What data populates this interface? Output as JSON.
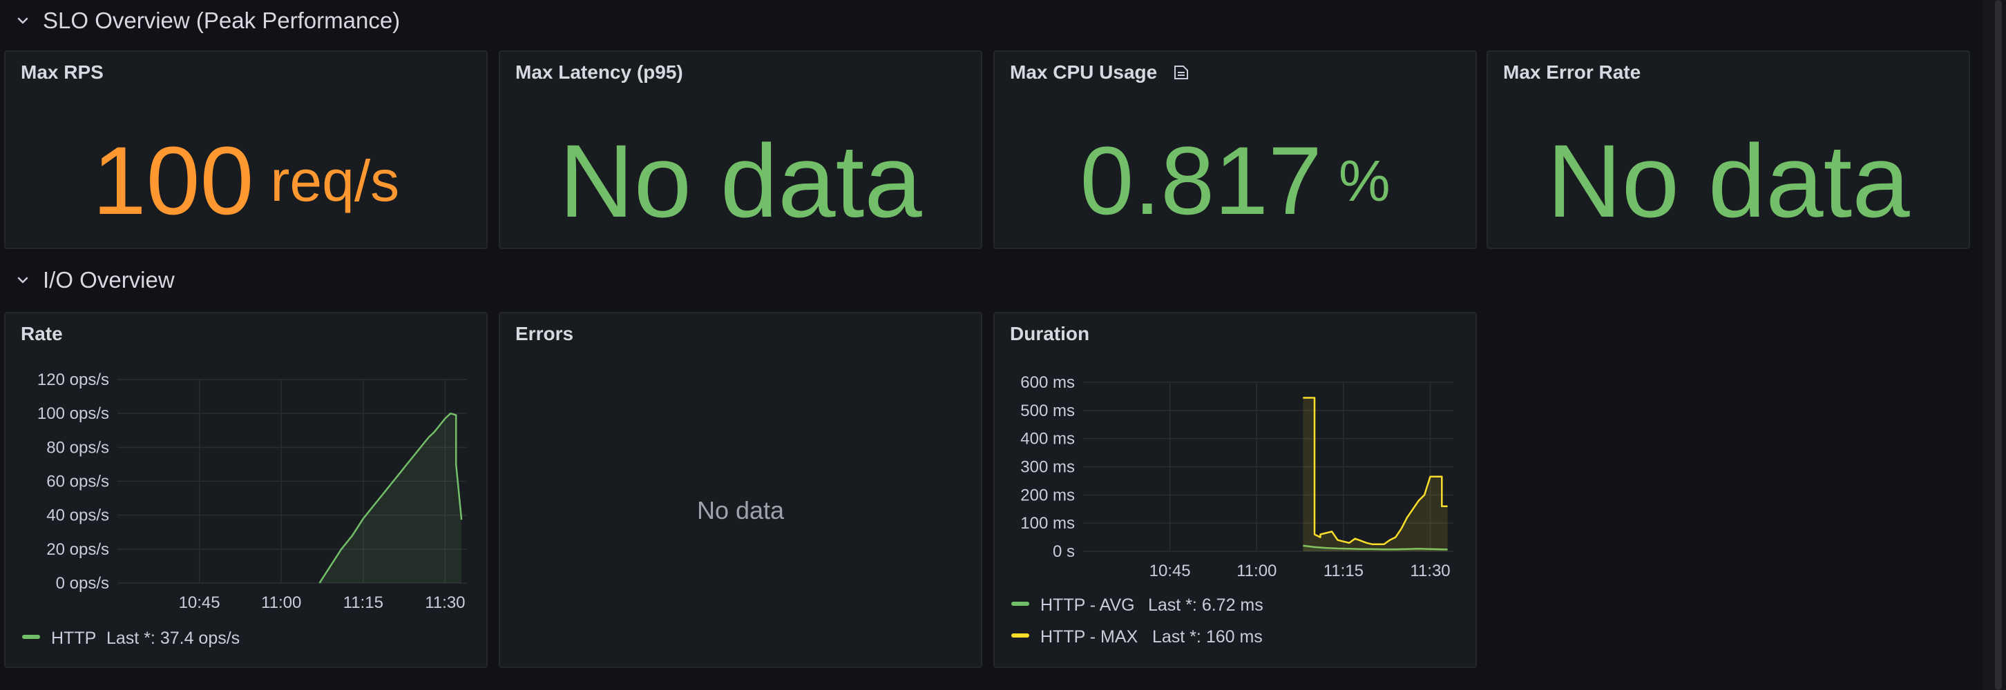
{
  "rows": [
    {
      "title": "SLO Overview (Peak Performance)"
    },
    {
      "title": "I/O Overview"
    }
  ],
  "stats": [
    {
      "title": "Max RPS",
      "value": "100",
      "unit": "req/s",
      "color": "#ff9830"
    },
    {
      "title": "Max Latency (p95)",
      "value": "No data",
      "unit": "",
      "color": "#73bf69"
    },
    {
      "title": "Max CPU Usage",
      "value": "0.817",
      "unit": "%",
      "color": "#73bf69"
    },
    {
      "title": "Max Error Rate",
      "value": "No data",
      "unit": "",
      "color": "#73bf69"
    }
  ],
  "panels": {
    "rate": {
      "title": "Rate"
    },
    "errors": {
      "title": "Errors",
      "message": "No data"
    },
    "duration": {
      "title": "Duration"
    }
  },
  "chart_data": [
    {
      "type": "area",
      "title": "Rate",
      "x_ticks": [
        "10:45",
        "11:00",
        "11:15",
        "11:30"
      ],
      "y_ticks": [
        "0 ops/s",
        "20 ops/s",
        "40 ops/s",
        "60 ops/s",
        "80 ops/s",
        "100 ops/s",
        "120 ops/s"
      ],
      "ylim": [
        0,
        120
      ],
      "grid": true,
      "legend": "bottom-left",
      "series": [
        {
          "name": "HTTP",
          "legend_text": "Last *: 37.4 ops/s",
          "color": "#73bf69",
          "x": [
            "11:07",
            "11:08",
            "11:09",
            "11:10",
            "11:11",
            "11:12",
            "11:13",
            "11:14",
            "11:15",
            "11:16",
            "11:17",
            "11:18",
            "11:19",
            "11:20",
            "11:21",
            "11:22",
            "11:23",
            "11:24",
            "11:25",
            "11:26",
            "11:27",
            "11:28",
            "11:29",
            "11:30",
            "11:31",
            "11:32",
            "11:32",
            "11:33"
          ],
          "values": [
            0,
            5,
            10,
            15,
            20,
            24,
            28,
            33,
            38,
            42,
            46,
            50,
            54,
            58,
            62,
            66,
            70,
            74,
            78,
            82,
            86,
            89,
            93,
            97,
            100,
            99,
            70,
            37.4
          ]
        }
      ]
    },
    {
      "type": "line",
      "title": "Duration",
      "x_ticks": [
        "10:45",
        "11:00",
        "11:15",
        "11:30"
      ],
      "y_ticks": [
        "0 s",
        "100 ms",
        "200 ms",
        "300 ms",
        "400 ms",
        "500 ms",
        "600 ms"
      ],
      "ylim": [
        0,
        600
      ],
      "grid": true,
      "legend": "bottom-left",
      "series": [
        {
          "name": "HTTP - AVG",
          "legend_text": "Last *: 6.72 ms",
          "color": "#73bf69",
          "x": [
            "11:08",
            "11:10",
            "11:12",
            "11:14",
            "11:16",
            "11:18",
            "11:20",
            "11:22",
            "11:24",
            "11:26",
            "11:28",
            "11:30",
            "11:32",
            "11:33"
          ],
          "values": [
            20,
            15,
            12,
            10,
            9,
            8,
            8,
            7,
            7,
            8,
            9,
            8,
            7,
            6.72
          ]
        },
        {
          "name": "HTTP - MAX",
          "legend_text": "Last *: 160 ms",
          "color": "#fade2a",
          "x": [
            "11:08",
            "11:10",
            "11:10",
            "11:11",
            "11:11",
            "11:13",
            "11:14",
            "11:16",
            "11:17",
            "11:19",
            "11:20",
            "11:22",
            "11:23",
            "11:24",
            "11:25",
            "11:26",
            "11:27",
            "11:28",
            "11:29",
            "11:30",
            "11:31",
            "11:32",
            "11:32",
            "11:33"
          ],
          "values": [
            545,
            545,
            60,
            50,
            60,
            70,
            40,
            30,
            45,
            30,
            25,
            25,
            40,
            50,
            80,
            120,
            150,
            180,
            200,
            265,
            265,
            265,
            160,
            160
          ]
        }
      ]
    }
  ]
}
